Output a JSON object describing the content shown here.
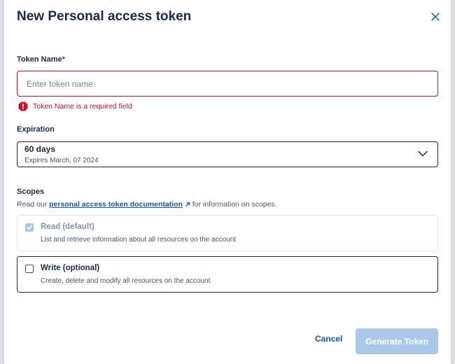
{
  "dialog": {
    "title": "New Personal access token"
  },
  "token_name": {
    "label": "Token Name",
    "required_marker": "*",
    "placeholder": "Enter token name",
    "value": "",
    "error": "Token Name is a required field"
  },
  "expiration": {
    "label": "Expiration",
    "selected": "60 days",
    "subtext": "Expires March, 07 2024"
  },
  "scopes": {
    "label": "Scopes",
    "desc_prefix": "Read our",
    "doc_link": "personal access token documentation",
    "desc_suffix": "for information on scopes.",
    "items": [
      {
        "title": "Read (default)",
        "desc": "List and retrieve information about all resources on the account",
        "checked": true
      },
      {
        "title": "Write (optional)",
        "desc": "Create, delete and modify all resources on the account",
        "checked": false
      }
    ]
  },
  "actions": {
    "cancel": "Cancel",
    "generate": "Generate Token"
  },
  "colors": {
    "error": "#c8102e",
    "link": "#1756a9",
    "primary_disabled": "#a9c8ea",
    "text": "#1b2a4a"
  },
  "icons": {
    "close": "close-icon",
    "error": "error-icon",
    "chevron": "chevron-down-icon",
    "external_link": "external-link-icon"
  }
}
